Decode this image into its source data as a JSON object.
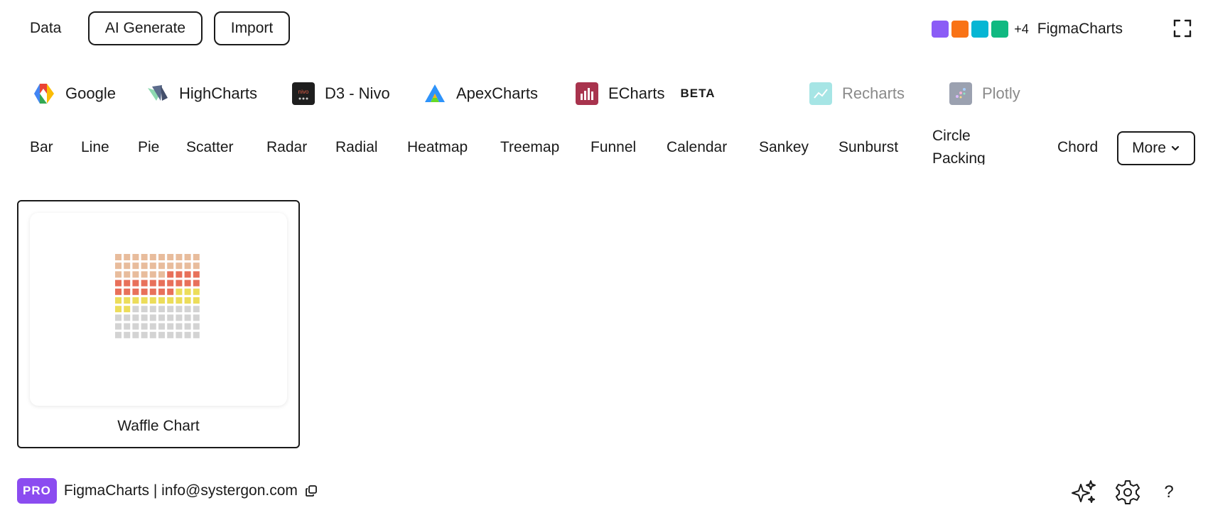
{
  "topbar": {
    "data_label": "Data",
    "ai_generate_label": "AI Generate",
    "import_label": "Import",
    "team_swatches": [
      "#8b5cf6",
      "#f97316",
      "#06b6d4",
      "#10b981"
    ],
    "team_more": "+4",
    "brand": "FigmaCharts",
    "fullscreen_icon": "expand-icon"
  },
  "libraries": [
    {
      "label": "Google",
      "icon": "google-charts-icon",
      "enabled": true
    },
    {
      "label": "HighCharts",
      "icon": "highcharts-icon",
      "enabled": true
    },
    {
      "label": "D3 - Nivo",
      "icon": "nivo-icon",
      "enabled": true
    },
    {
      "label": "ApexCharts",
      "icon": "apexcharts-icon",
      "enabled": true
    },
    {
      "label": "ECharts",
      "icon": "echarts-icon",
      "enabled": true,
      "badge": "BETA"
    },
    {
      "label": "Recharts",
      "icon": "recharts-icon",
      "enabled": false
    },
    {
      "label": "Plotly",
      "icon": "plotly-icon",
      "enabled": false
    }
  ],
  "chart_types": [
    "Bar",
    "Line",
    "Pie",
    "Scatter",
    "Radar",
    "Radial",
    "Heatmap",
    "Treemap",
    "Funnel",
    "Calendar",
    "Sankey",
    "Sunburst",
    "Circle Packing",
    "Chord"
  ],
  "more_label": "More",
  "cards": [
    {
      "title": "Waffle Chart",
      "thumbnail": "waffle-chart-thumbnail"
    }
  ],
  "waffle": {
    "rows": 10,
    "cols": 10,
    "segments": [
      {
        "count": 26,
        "color": "#e8bc9c"
      },
      {
        "count": 21,
        "color": "#e8705a"
      },
      {
        "count": 15,
        "color": "#ecdd5a"
      },
      {
        "count": 38,
        "color": "#d3d3d3"
      }
    ]
  },
  "footer": {
    "pro_label": "PRO",
    "text": "FigmaCharts | info@systergon.com",
    "copy_icon": "copy-icon",
    "ai_icon": "sparkles-icon",
    "settings_icon": "gear-icon",
    "help_label": "?"
  }
}
